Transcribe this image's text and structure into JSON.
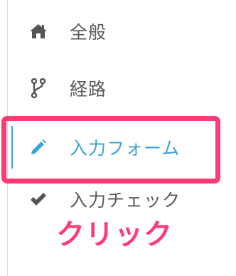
{
  "menu": {
    "items": [
      {
        "label": "全般",
        "icon": "home-icon",
        "active": false
      },
      {
        "label": "経路",
        "icon": "branch-icon",
        "active": false
      },
      {
        "label": "入力フォーム",
        "icon": "pencil-icon",
        "active": true
      },
      {
        "label": "入力チェック",
        "icon": "check-icon",
        "active": false
      }
    ]
  },
  "annotation": {
    "text": "クリック"
  },
  "colors": {
    "default_text": "#5a5a5a",
    "icon": "#555555",
    "active": "#3aa3d6",
    "highlight": "#ff3b77"
  }
}
